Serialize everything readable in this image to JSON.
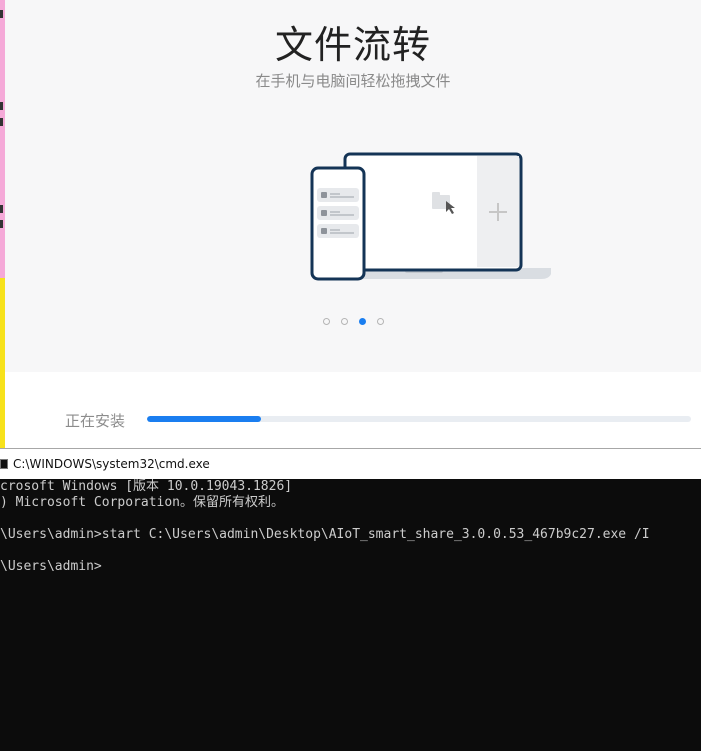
{
  "installer": {
    "title": "文件流转",
    "subtitle": "在手机与电脑间轻松拖拽文件",
    "carousel": {
      "count": 4,
      "active_index": 2
    },
    "progress": {
      "label": "正在安装",
      "fraction": 0.21,
      "accent": "#1a7ef0"
    }
  },
  "cmd": {
    "title": "C:\\WINDOWS\\system32\\cmd.exe",
    "lines": [
      "crosoft Windows [版本 10.0.19043.1826]",
      ") Microsoft Corporation。保留所有权利。",
      "",
      "\\Users\\admin>start C:\\Users\\admin\\Desktop\\AIoT_smart_share_3.0.0.53_467b9c27.exe /I",
      "",
      "\\Users\\admin>"
    ]
  },
  "icons": {
    "cmd": "cmd-window-icon",
    "cursor": "cursor-icon",
    "plus": "plus-icon",
    "folder": "folder-icon"
  }
}
